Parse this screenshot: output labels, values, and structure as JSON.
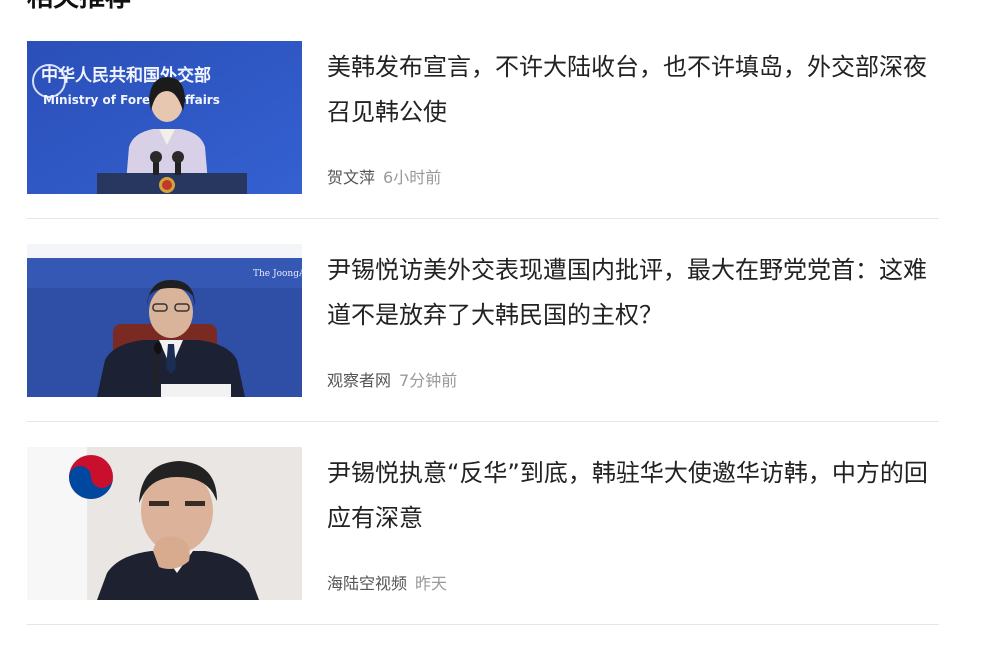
{
  "section": {
    "title": "相关推荐"
  },
  "articles": [
    {
      "headline": "美韩发布宣言，不许大陆收台，也不许填岛，外交部深夜召见韩公使",
      "source": "贺文萍",
      "time": "6小时前",
      "image_text": {
        "line1": "中华人民共和国外交部",
        "line2": "Ministry of Foreign Affairs"
      }
    },
    {
      "headline": "尹锡悦访美外交表现遭国内批评，最大在野党党首：这难道不是放弃了大韩民国的主权？",
      "source": "观察者网",
      "time": "7分钟前",
      "image_text": {
        "watermark": "The JoongAng"
      }
    },
    {
      "headline": "尹锡悦执意“反华”到底，韩驻华大使邀华访韩，中方的回应有深意",
      "source": "海陆空视频",
      "time": "昨天"
    }
  ],
  "colors": {
    "headline": "#222222",
    "source": "#555555",
    "time": "#999999",
    "divider": "#e6e6e6"
  }
}
